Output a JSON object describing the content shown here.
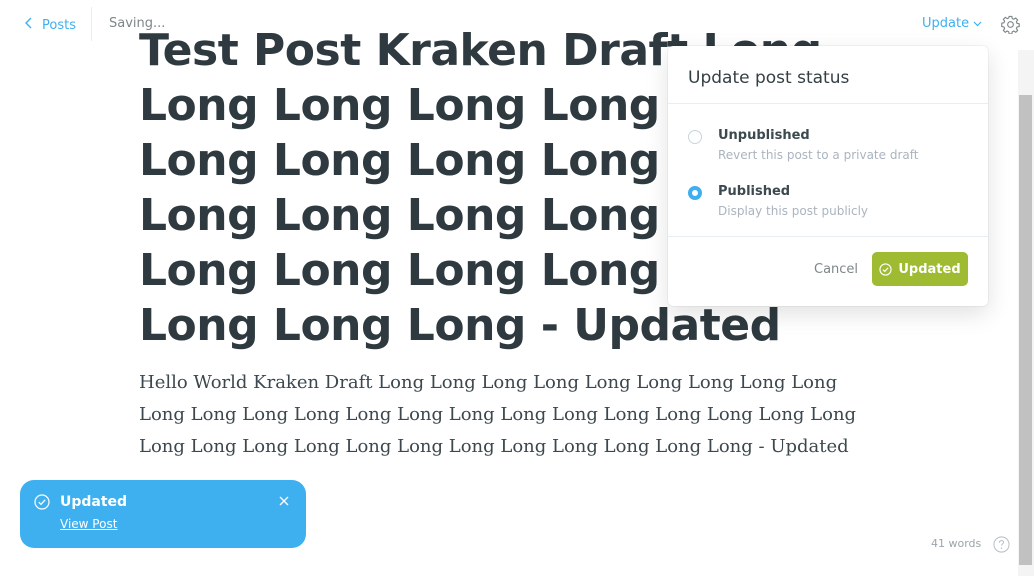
{
  "header": {
    "back_label": "Posts",
    "status_text": "Saving...",
    "update_menu_label": "Update"
  },
  "editor": {
    "title": "Test Post Kraken Draft Long Long Long Long Long Long Long Long Long Long Long Long Long Long Long Long Long Long Long Long Long Long Long Long - Updated",
    "body": "Hello World Kraken Draft Long Long Long Long Long Long Long Long Long Long Long Long Long Long Long Long Long Long Long Long Long Long Long Long Long Long Long Long Long Long Long Long Long Long Long - Updated"
  },
  "popover": {
    "title": "Update post status",
    "options": [
      {
        "label": "Unpublished",
        "description": "Revert this post to a private draft",
        "selected": false
      },
      {
        "label": "Published",
        "description": "Display this post publicly",
        "selected": true
      }
    ],
    "cancel_label": "Cancel",
    "confirm_label": "Updated"
  },
  "toast": {
    "title": "Updated",
    "link_label": "View Post"
  },
  "footer": {
    "word_count": "41 words"
  },
  "colors": {
    "accent": "#3eb0ef",
    "success": "#9fbb32"
  },
  "icons": {
    "back": "chevron-left-icon",
    "dropdown": "chevron-down-icon",
    "settings": "gear-icon",
    "check": "check-circle-icon",
    "close": "close-icon",
    "help": "question-circle-icon"
  }
}
